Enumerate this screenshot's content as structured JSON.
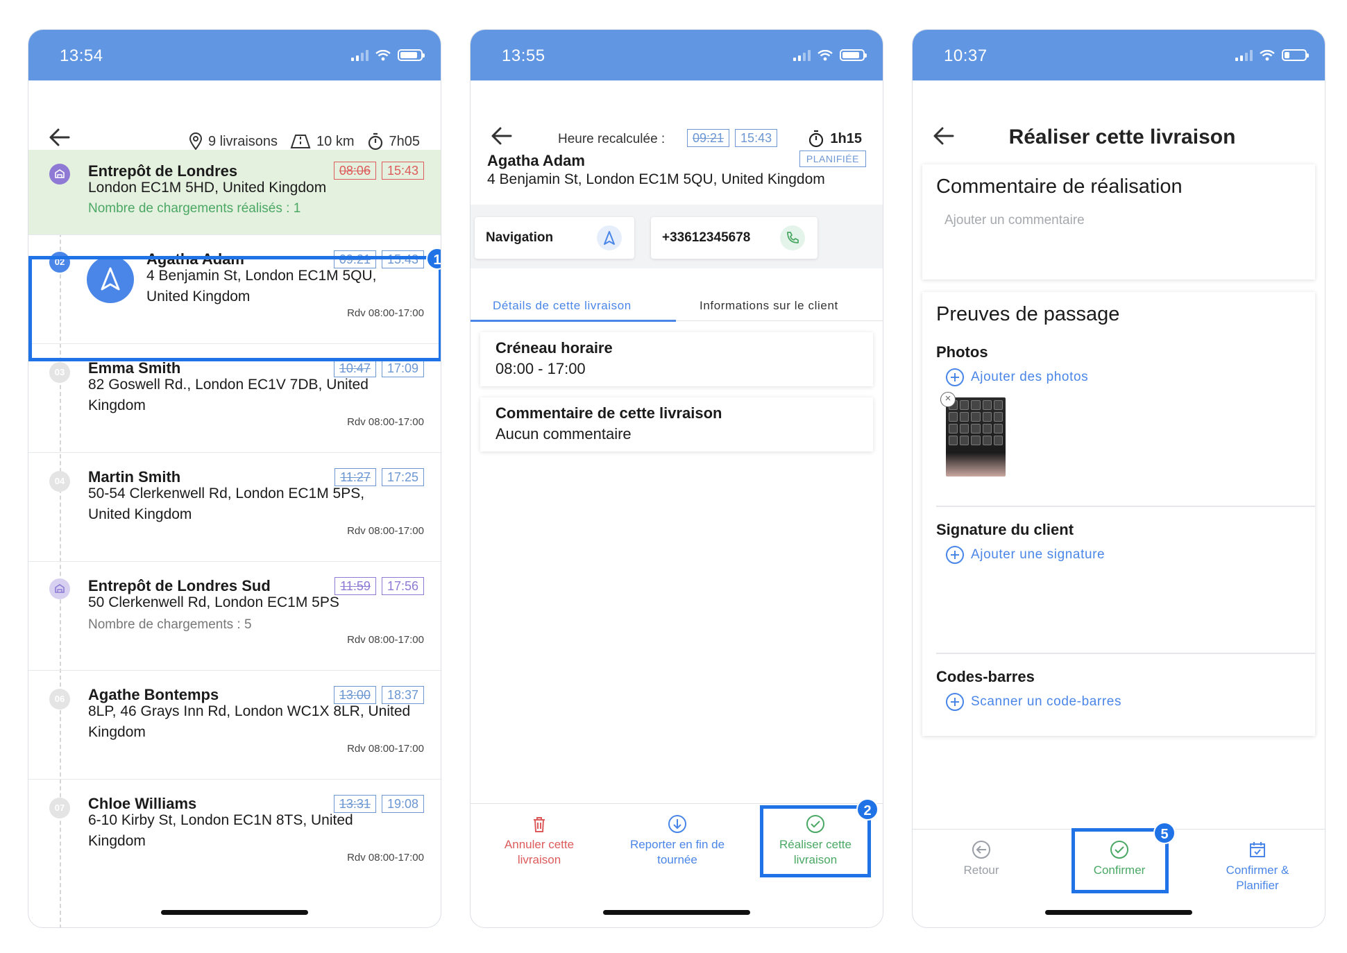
{
  "screen1": {
    "time": "13:54",
    "summary": {
      "deliveries": "9 livraisons",
      "distance": "10 km",
      "duration": "7h05"
    },
    "rows": [
      {
        "name": "Entrepôt de Londres",
        "address": "London EC1M 5HD, United Kingdom",
        "extra": "Nombre de chargements réalisés : 1",
        "old_time": "08:06",
        "new_time": "15:43"
      },
      {
        "num": "02",
        "name": "Agatha Adam",
        "address_l1": "4 Benjamin St, London EC1M 5QU,",
        "address_l2": "United Kingdom",
        "old_time": "09:21",
        "new_time": "15:43",
        "rdv": "Rdv 08:00-17:00"
      },
      {
        "num": "03",
        "name": "Emma Smith",
        "address_l1": "82 Goswell Rd., London EC1V 7DB, United",
        "address_l2": "Kingdom",
        "old_time": "10:47",
        "new_time": "17:09",
        "rdv": "Rdv 08:00-17:00"
      },
      {
        "num": "04",
        "name": "Martin Smith",
        "address_l1": "50-54 Clerkenwell Rd, London EC1M 5PS,",
        "address_l2": "United Kingdom",
        "old_time": "11:27",
        "new_time": "17:25",
        "rdv": "Rdv 08:00-17:00"
      },
      {
        "name": "Entrepôt de Londres Sud",
        "address_l1": "50 Clerkenwell Rd, London EC1M 5PS",
        "extra": "Nombre de chargements : 5",
        "old_time": "11:59",
        "new_time": "17:56",
        "rdv": "Rdv 08:00-17:00"
      },
      {
        "num": "06",
        "name": "Agathe Bontemps",
        "address_l1": "8LP, 46 Grays Inn Rd, London WC1X 8LR, United",
        "address_l2": "Kingdom",
        "old_time": "13:00",
        "new_time": "18:37",
        "rdv": "Rdv 08:00-17:00"
      },
      {
        "num": "07",
        "name": "Chloe Williams",
        "address_l1": "6-10 Kirby St, London EC1N 8TS, United",
        "address_l2": "Kingdom",
        "old_time": "13:31",
        "new_time": "19:08",
        "rdv": "Rdv 08:00-17:00"
      }
    ],
    "step": "1"
  },
  "screen2": {
    "time": "13:55",
    "recalc_label": "Heure recalculée :",
    "old_time": "09:21",
    "new_time": "15:43",
    "duration": "1h15",
    "customer_name": "Agatha Adam",
    "customer_address": "4 Benjamin St, London EC1M 5QU, United Kingdom",
    "status_badge": "PLANIFIÉE",
    "navigation_label": "Navigation",
    "phone": "+33612345678",
    "tabs": [
      "Détails de cette livraison",
      "Informations sur le client"
    ],
    "slot_title": "Créneau horaire",
    "slot_value": "08:00 - 17:00",
    "comment_title": "Commentaire de cette livraison",
    "comment_value": "Aucun commentaire",
    "actions": {
      "cancel_l1": "Annuler cette",
      "cancel_l2": "livraison",
      "postpone_l1": "Reporter en fin de",
      "postpone_l2": "tournée",
      "complete_l1": "Réaliser cette",
      "complete_l2": "livraison"
    },
    "step": "2"
  },
  "screen3": {
    "time": "10:37",
    "title": "Réaliser cette livraison",
    "comment_header": "Commentaire de réalisation",
    "comment_placeholder": "Ajouter un commentaire",
    "proofs_header": "Preuves de passage",
    "photos_label": "Photos",
    "add_photos": "Ajouter des photos",
    "signature_label": "Signature du client",
    "add_signature": "Ajouter une signature",
    "barcodes_label": "Codes-barres",
    "scan_barcode": "Scanner un code-barres",
    "actions": {
      "back": "Retour",
      "confirm": "Confirmer",
      "confirm_plan_l1": "Confirmer &",
      "confirm_plan_l2": "Planifier"
    },
    "step": "5"
  },
  "colors": {
    "header_blue": "#6196e3",
    "accent_blue": "#1f73e6",
    "link_blue": "#4a86e8",
    "danger": "#dd5b5b",
    "success_green": "#4aa864",
    "warehouse_purple": "#8e7ad4"
  }
}
